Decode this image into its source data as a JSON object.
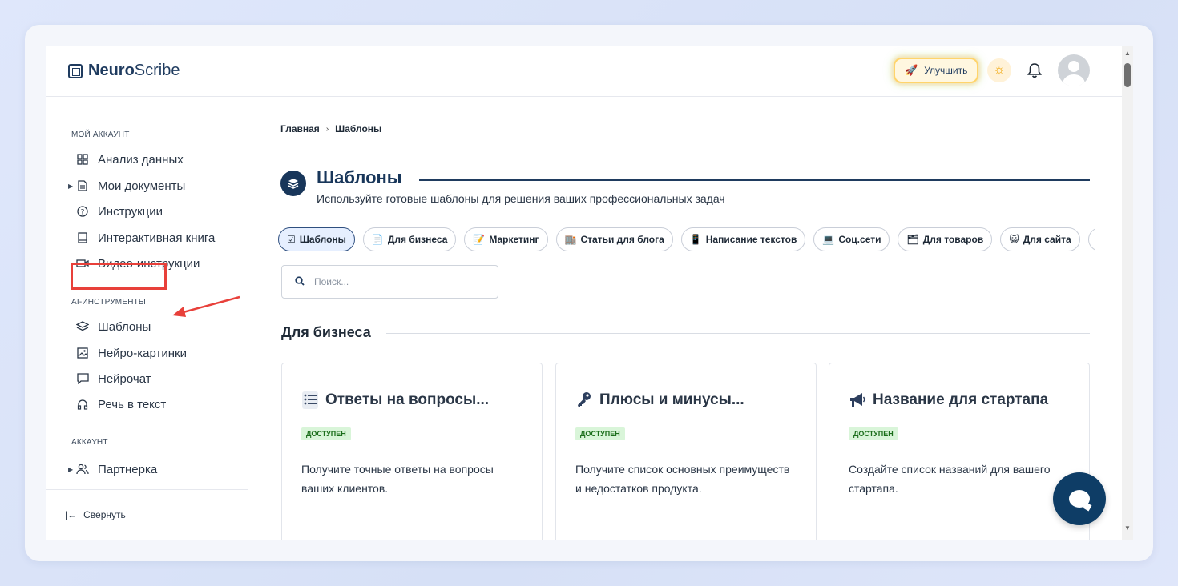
{
  "brand": {
    "bold": "Neuro",
    "rest": "Scribe"
  },
  "header": {
    "upgrade_label": "Улучшить"
  },
  "sidebar": {
    "sections": [
      {
        "title": "МОЙ АККАУНТ"
      },
      {
        "title": "AI-ИНСТРУМЕНТЫ"
      },
      {
        "title": "АККАУНТ"
      }
    ],
    "items": [
      {
        "label": "Анализ данных"
      },
      {
        "label": "Мои документы"
      },
      {
        "label": "Инструкции"
      },
      {
        "label": "Интерактивная книга"
      },
      {
        "label": "Видео-инструкции"
      },
      {
        "label": "Шаблоны"
      },
      {
        "label": "Нейро-картинки"
      },
      {
        "label": "Нейрочат"
      },
      {
        "label": "Речь в текст"
      },
      {
        "label": "Партнерка"
      }
    ],
    "collapse_label": "Свернуть"
  },
  "breadcrumb": {
    "home": "Главная",
    "current": "Шаблоны"
  },
  "page": {
    "title": "Шаблоны",
    "subtitle": "Используйте готовые шаблоны для решения ваших профессиональных задач"
  },
  "chips": [
    {
      "label": "Шаблоны",
      "emoji": "☑"
    },
    {
      "label": "Для бизнеса",
      "emoji": "📄"
    },
    {
      "label": "Маркетинг",
      "emoji": "📝"
    },
    {
      "label": "Статьи для блога",
      "emoji": "🏬"
    },
    {
      "label": "Написание текстов",
      "emoji": "📱"
    },
    {
      "label": "Соц.сети",
      "emoji": "💻"
    },
    {
      "label": "Для товаров",
      "emoji": "🗂"
    },
    {
      "label": "Для сайта",
      "emoji": "😺"
    }
  ],
  "search": {
    "placeholder": "Поиск..."
  },
  "section": {
    "title": "Для бизнеса"
  },
  "cards": [
    {
      "title": "Ответы на вопросы...",
      "badge": "ДОСТУПЕН",
      "desc": "Получите точные ответы на вопросы ваших клиентов."
    },
    {
      "title": "Плюсы и минусы...",
      "badge": "ДОСТУПЕН",
      "desc": "Получите список основных преимуществ и недостатков продукта."
    },
    {
      "title": "Название для стартапа",
      "badge": "ДОСТУПЕН",
      "desc": "Создайте список названий для вашего стартапа."
    }
  ],
  "colors": {
    "accent": "#18365a",
    "highlight": "#e8403a",
    "badge_bg": "#d9f5d9"
  }
}
